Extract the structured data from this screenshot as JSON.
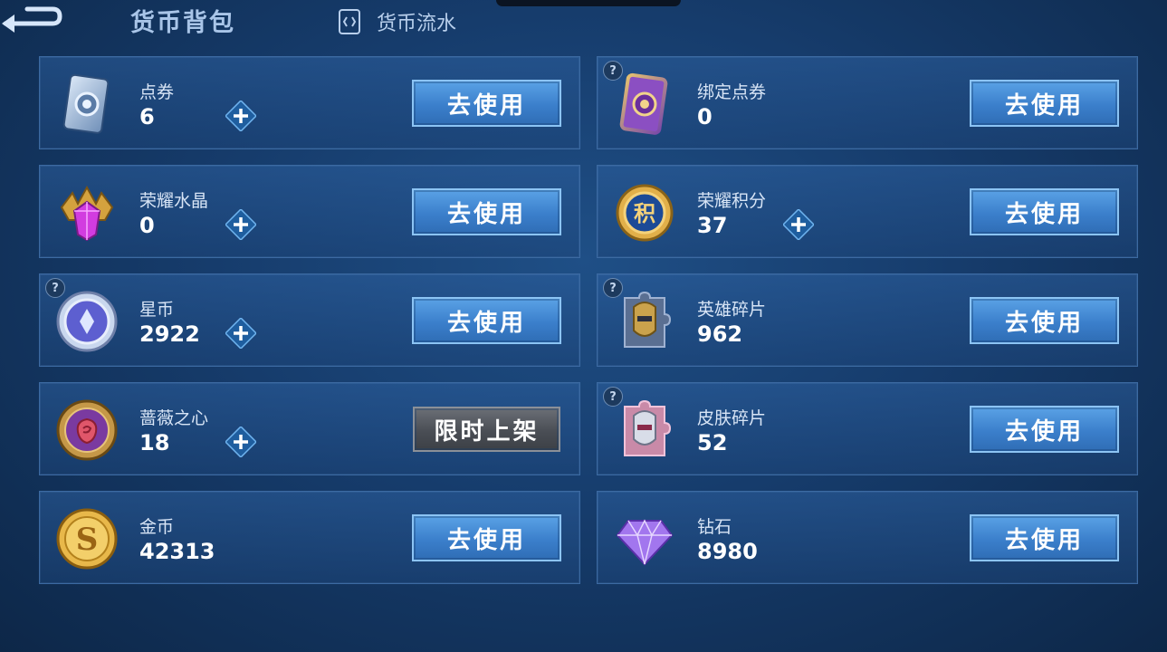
{
  "header": {
    "title": "货币背包",
    "flow_link": "货币流水"
  },
  "cards": [
    {
      "name": "点券",
      "amount": "6",
      "has_plus": true,
      "has_help": false,
      "button": "去使用",
      "icon": "voucher-icon"
    },
    {
      "name": "绑定点券",
      "amount": "0",
      "has_plus": false,
      "has_help": true,
      "button": "去使用",
      "icon": "bound-voucher-icon"
    },
    {
      "name": "荣耀水晶",
      "amount": "0",
      "has_plus": true,
      "has_help": false,
      "button": "去使用",
      "icon": "glory-crystal-icon"
    },
    {
      "name": "荣耀积分",
      "amount": "37",
      "has_plus": true,
      "has_help": false,
      "button": "去使用",
      "icon": "glory-points-icon"
    },
    {
      "name": "星币",
      "amount": "2922",
      "has_plus": true,
      "has_help": true,
      "button": "去使用",
      "icon": "star-coin-icon"
    },
    {
      "name": "英雄碎片",
      "amount": "962",
      "has_plus": false,
      "has_help": true,
      "button": "去使用",
      "icon": "hero-fragment-icon"
    },
    {
      "name": "蔷薇之心",
      "amount": "18",
      "has_plus": true,
      "has_help": false,
      "button": "限时上架",
      "icon": "rose-heart-icon"
    },
    {
      "name": "皮肤碎片",
      "amount": "52",
      "has_plus": false,
      "has_help": true,
      "button": "去使用",
      "icon": "skin-fragment-icon"
    },
    {
      "name": "金币",
      "amount": "42313",
      "has_plus": false,
      "has_help": false,
      "button": "去使用",
      "icon": "gold-coin-icon"
    },
    {
      "name": "钻石",
      "amount": "8980",
      "has_plus": false,
      "has_help": false,
      "button": "去使用",
      "icon": "diamond-icon"
    }
  ],
  "colors": {
    "accent_button": "#3b7fcb",
    "limited_button": "#4a4e55",
    "background": "#163c6c"
  }
}
